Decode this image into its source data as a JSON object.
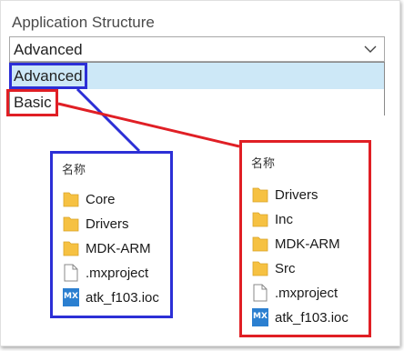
{
  "section": {
    "title": "Application Structure"
  },
  "combo": {
    "selected_value": "Advanced",
    "chevron_icon": "chevron-down-icon"
  },
  "dropdown": {
    "options": [
      {
        "label": "Advanced",
        "selected": true
      },
      {
        "label": "Basic",
        "selected": false
      }
    ]
  },
  "colors": {
    "annotation_blue": "#2c2fd6",
    "annotation_red": "#e01f25",
    "selection_bg": "#cde8f7",
    "folder": "#f6c142",
    "mx_icon": "#2b7fd0"
  },
  "advanced_panel": {
    "header": "名称",
    "items": [
      {
        "name": "Core",
        "icon": "folder-icon"
      },
      {
        "name": "Drivers",
        "icon": "folder-icon"
      },
      {
        "name": "MDK-ARM",
        "icon": "folder-icon"
      },
      {
        "name": ".mxproject",
        "icon": "file-icon"
      },
      {
        "name": "atk_f103.ioc",
        "icon": "mx-icon",
        "icon_text": "MX"
      }
    ]
  },
  "basic_panel": {
    "header": "名称",
    "items": [
      {
        "name": "Drivers",
        "icon": "folder-icon"
      },
      {
        "name": "Inc",
        "icon": "folder-icon"
      },
      {
        "name": "MDK-ARM",
        "icon": "folder-icon"
      },
      {
        "name": "Src",
        "icon": "folder-icon"
      },
      {
        "name": ".mxproject",
        "icon": "file-icon"
      },
      {
        "name": "atk_f103.ioc",
        "icon": "mx-icon",
        "icon_text": "MX"
      }
    ]
  }
}
